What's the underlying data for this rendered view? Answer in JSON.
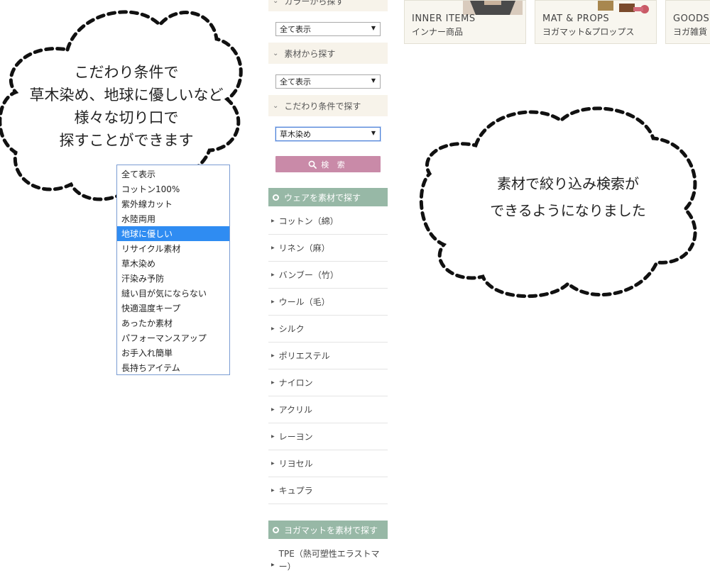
{
  "sidebar": {
    "color_filter": {
      "label": "カラーから探す",
      "value": "全て表示"
    },
    "material_filter": {
      "label": "素材から探す",
      "value": "全て表示"
    },
    "feature_filter": {
      "label": "こだわり条件で探す",
      "value": "草木染め"
    },
    "search_button": "検 索",
    "wear_section": "ウェアを素材で探す",
    "materials": [
      "コットン（綿）",
      "リネン（麻）",
      "バンブー（竹）",
      "ウール（毛）",
      "シルク",
      "ポリエステル",
      "ナイロン",
      "アクリル",
      "レーヨン",
      "リヨセル",
      "キュプラ"
    ],
    "mat_section": "ヨガマットを素材で探す",
    "mat_first_item": "TPE（熱可塑性エラストマー）"
  },
  "dropdown": {
    "options": [
      "全て表示",
      "コットン100%",
      "紫外線カット",
      "水陸両用",
      "地球に優しい",
      "リサイクル素材",
      "草木染め",
      "汗染み予防",
      "縫い目が気にならない",
      "快適温度キープ",
      "あったか素材",
      "パフォーマンスアップ",
      "お手入れ簡単",
      "長持ちアイテム"
    ],
    "highlighted": "地球に優しい"
  },
  "categories": [
    {
      "en": "INNER ITEMS",
      "jp": "インナー商品"
    },
    {
      "en": "MAT & PROPS",
      "jp": "ヨガマット&プロップス"
    },
    {
      "en": "GOODS",
      "jp": "ヨガ雑貨"
    }
  ],
  "bubbles": {
    "left": [
      "こだわり条件で",
      "草木染め、地球に優しいなど",
      "様々な切り口で",
      "探すことができます"
    ],
    "right": [
      "素材で絞り込み検索が",
      "できるようになりました"
    ]
  },
  "colors": {
    "accent_pink": "#c98aa8",
    "section_green": "#97b8a6",
    "filter_bg": "#f7f3ea",
    "selected_option": "#2f8cf2"
  }
}
